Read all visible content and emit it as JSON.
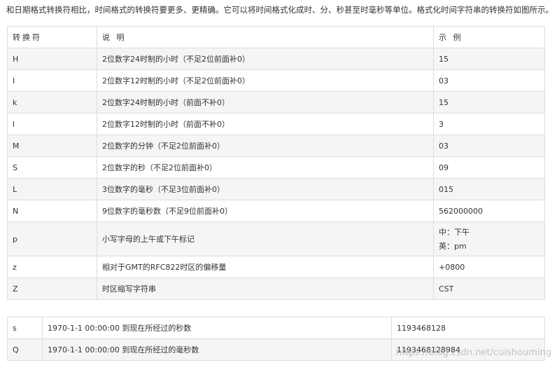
{
  "intro": "和日期格式转换符相比，时间格式的转换符要更多、更精确。它可以将时间格式化成时、分、秒甚至时毫秒等单位。格式化时间字符串的转换符如图所示。",
  "main_table": {
    "headers": [
      "转换符",
      "说  明",
      "示  例"
    ],
    "rows": [
      {
        "symbol": "H",
        "desc": "2位数字24时制的小时（不足2位前面补0）",
        "example": "15"
      },
      {
        "symbol": "I",
        "desc": "2位数字12时制的小时（不足2位前面补0）",
        "example": "03"
      },
      {
        "symbol": "k",
        "desc": "2位数字24时制的小时（前面不补0）",
        "example": "15"
      },
      {
        "symbol": "l",
        "desc": "2位数字12时制的小时（前面不补0）",
        "example": "3"
      },
      {
        "symbol": "M",
        "desc": "2位数字的分钟（不足2位前面补0）",
        "example": "03"
      },
      {
        "symbol": "S",
        "desc": "2位数字的秒（不足2位前面补0）",
        "example": "09"
      },
      {
        "symbol": "L",
        "desc": "3位数字的毫秒（不足3位前面补0）",
        "example": "015"
      },
      {
        "symbol": "N",
        "desc": "9位数字的毫秒数（不足9位前面补0）",
        "example": "562000000"
      },
      {
        "symbol": "p",
        "desc": "小写字母的上午或下午标记",
        "example": "中：下午",
        "example2": "英：pm"
      },
      {
        "symbol": "z",
        "desc": "相对于GMT的RFC822时区的偏移量",
        "example": "+0800"
      },
      {
        "symbol": "Z",
        "desc": "时区缩写字符串",
        "example": "CST"
      }
    ]
  },
  "extra_table": {
    "rows": [
      {
        "symbol": "s",
        "desc": "1970-1-1 00:00:00 到现在所经过的秒数",
        "example": "1193468128"
      },
      {
        "symbol": "Q",
        "desc": "1970-1-1 00:00:00 到现在所经过的毫秒数",
        "example": "1193468128984"
      }
    ]
  },
  "watermark": "https://blog.csdn.net/cuishouming"
}
